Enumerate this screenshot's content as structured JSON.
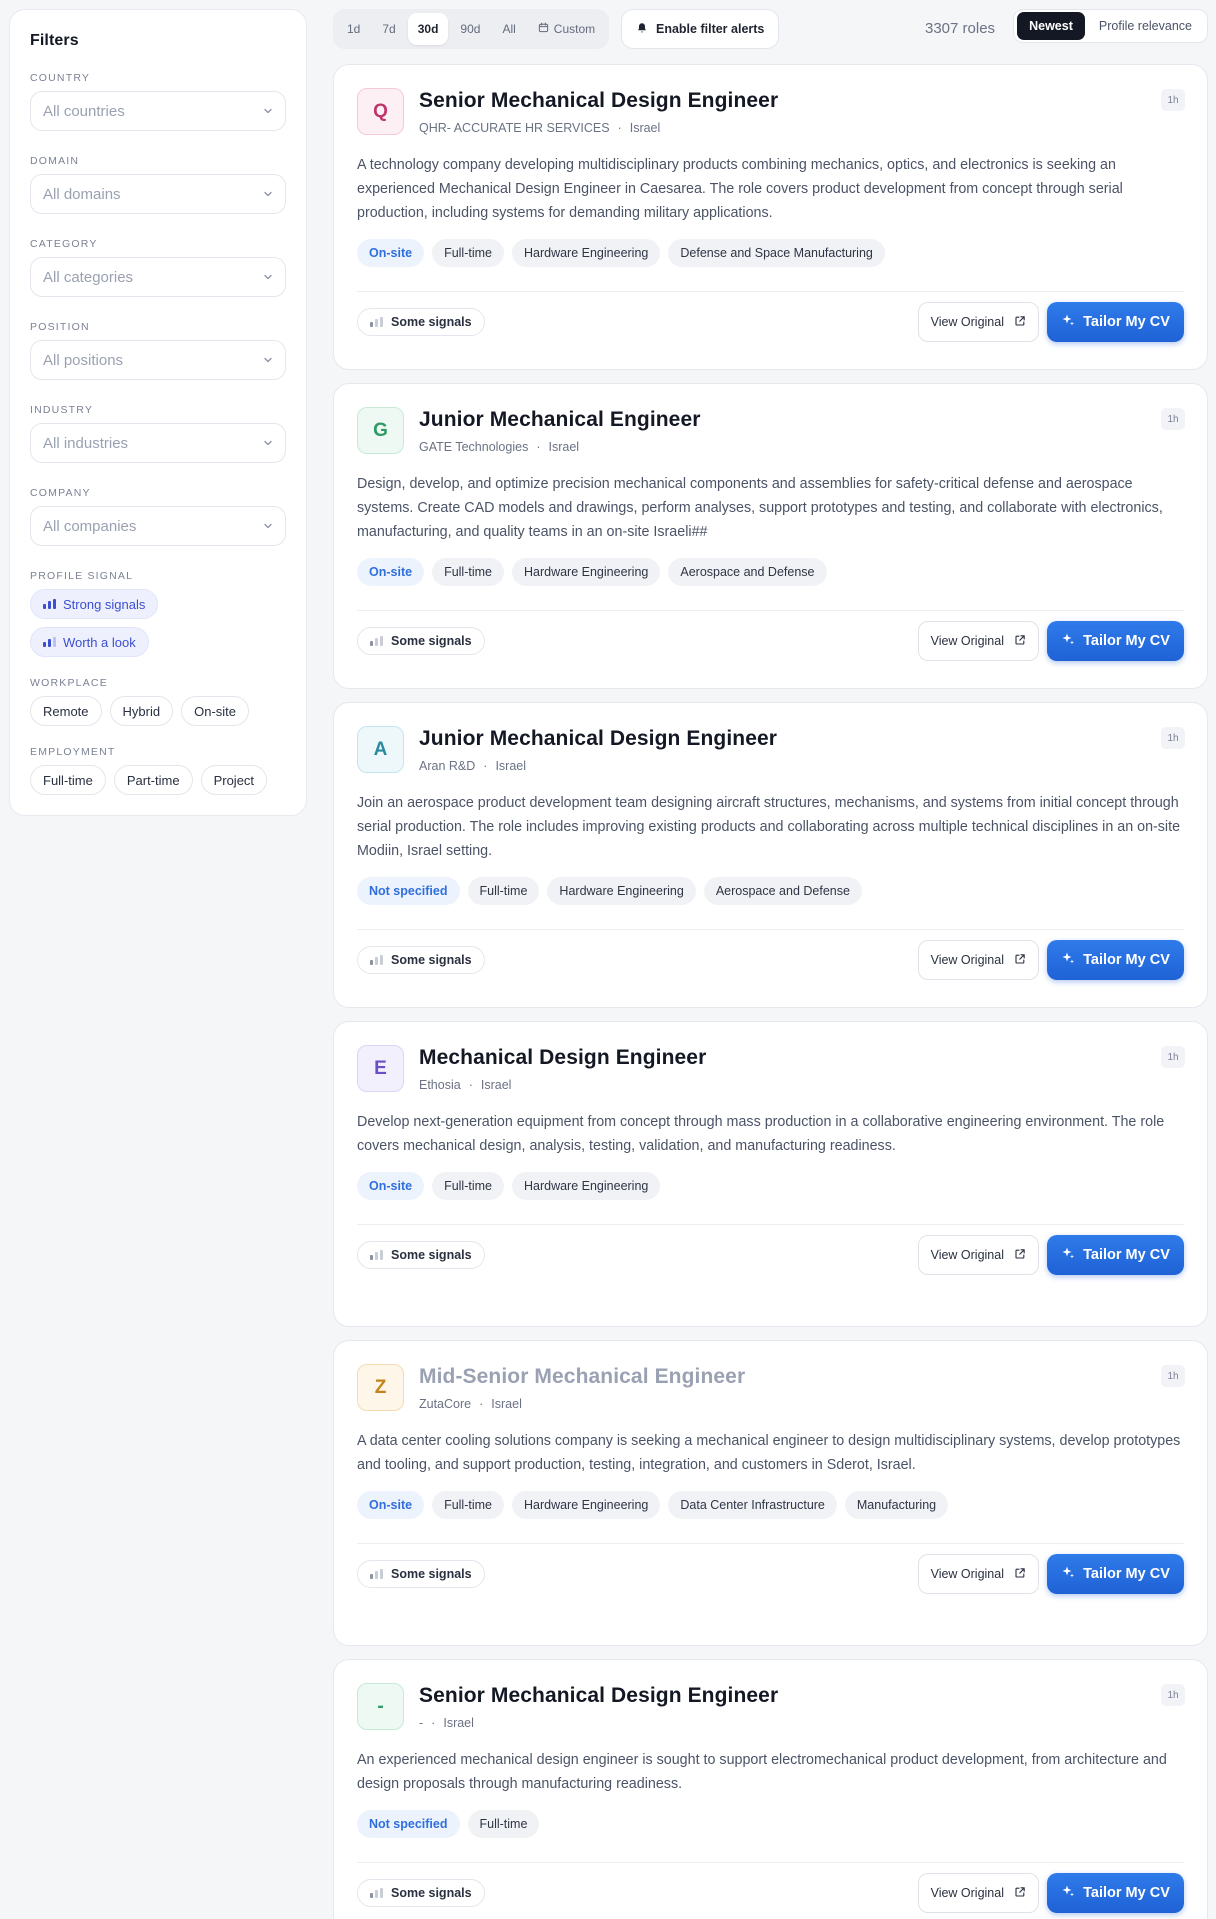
{
  "sidebar": {
    "title": "Filters",
    "country": {
      "label": "COUNTRY",
      "value": "All countries"
    },
    "domain": {
      "label": "DOMAIN",
      "value": "All domains"
    },
    "category": {
      "label": "CATEGORY",
      "value": "All categories"
    },
    "position": {
      "label": "POSITION",
      "value": "All positions"
    },
    "industry": {
      "label": "INDUSTRY",
      "value": "All industries"
    },
    "company": {
      "label": "COMPANY",
      "value": "All companies"
    },
    "profile_signal": {
      "label": "PROFILE SIGNAL",
      "options": [
        "Strong signals",
        "Worth a look"
      ]
    },
    "workplace": {
      "label": "WORKPLACE",
      "options": [
        "Remote",
        "Hybrid",
        "On-site"
      ]
    },
    "employment": {
      "label": "EMPLOYMENT",
      "options": [
        "Full-time",
        "Part-time",
        "Project"
      ]
    }
  },
  "topbar": {
    "ranges": [
      "1d",
      "7d",
      "30d",
      "90d",
      "All"
    ],
    "active_range": "30d",
    "custom_label": "Custom",
    "alerts_label": "Enable filter alerts",
    "roles_count": "3307 roles",
    "sort": [
      "Newest",
      "Profile relevance"
    ],
    "active_sort": "Newest"
  },
  "actions": {
    "view_original": "View Original",
    "tailor": "Tailor My CV",
    "signals": "Some signals"
  },
  "jobs": [
    {
      "initial": "Q",
      "title": "Senior Mechanical Design Engineer",
      "company": "QHR- ACCURATE HR SERVICES",
      "country": "Israel",
      "age": "1h",
      "description": "A technology company developing multidisciplinary products combining mechanics, optics, and electronics is seeking an experienced Mechanical Design Engineer in Caesarea. The role covers product development from concept through serial production, including systems for demanding military applications.",
      "location_type": "On-site",
      "tags": [
        "Full-time",
        "Hardware Engineering",
        "Defense and Space Manufacturing"
      ],
      "logo_color": "#c0356b",
      "logo_bg": "#fdf0f4",
      "logo_border": "#f4c9d7"
    },
    {
      "initial": "G",
      "title": "Junior Mechanical Engineer",
      "company": "GATE Technologies",
      "country": "Israel",
      "age": "1h",
      "description": "Design, develop, and optimize precision mechanical components and assemblies for safety-critical defense and aerospace systems. Create CAD models and drawings, perform analyses, support prototypes and testing, and collaborate with electronics, manufacturing, and quality teams in an on-site Israeli##",
      "location_type": "On-site",
      "tags": [
        "Full-time",
        "Hardware Engineering",
        "Aerospace and Defense"
      ],
      "logo_color": "#2f9a66",
      "logo_bg": "#eef9f3",
      "logo_border": "#c6ead6"
    },
    {
      "initial": "A",
      "title": "Junior Mechanical Design Engineer",
      "company": "Aran R&D",
      "country": "Israel",
      "age": "1h",
      "description": "Join an aerospace product development team designing aircraft structures, mechanisms, and systems from initial concept through serial production. The role includes improving existing products and collaborating across multiple technical disciplines in an on-site Modiin, Israel setting.",
      "location_type": "Not specified",
      "tags": [
        "Full-time",
        "Hardware Engineering",
        "Aerospace and Defense"
      ],
      "logo_color": "#2a8aa0",
      "logo_bg": "#eef8fb",
      "logo_border": "#c5e5ee"
    },
    {
      "initial": "E",
      "title": "Mechanical Design Engineer",
      "company": "Ethosia",
      "country": "Israel",
      "age": "1h",
      "description": "Develop next-generation equipment from concept through mass production in a collaborative engineering environment. The role covers mechanical design, analysis, testing, validation, and manufacturing readiness.",
      "location_type": "On-site",
      "tags": [
        "Full-time",
        "Hardware Engineering"
      ],
      "logo_color": "#6a4fc4",
      "logo_bg": "#f3f0fd",
      "logo_border": "#dcd3f6"
    },
    {
      "initial": "Z",
      "title": "Mid-Senior Mechanical Engineer",
      "company": "ZutaCore",
      "country": "Israel",
      "age": "1h",
      "description": "A data center cooling solutions company is seeking a mechanical engineer to design multidisciplinary systems, develop prototypes and tooling, and support production, testing, integration, and customers in Sderot, Israel.",
      "location_type": "On-site",
      "tags": [
        "Full-time",
        "Hardware Engineering",
        "Data Center Infrastructure",
        "Manufacturing"
      ],
      "logo_color": "#c4841c",
      "logo_bg": "#fdf6e9",
      "logo_border": "#f2ddb3",
      "muted": true
    },
    {
      "initial": "-",
      "title": "Senior Mechanical Design Engineer",
      "company": "-",
      "country": "Israel",
      "age": "1h",
      "description": "An experienced mechanical design engineer is sought to support electromechanical product development, from architecture and design proposals through manufacturing readiness.",
      "location_type": "Not specified",
      "tags": [
        "Full-time"
      ],
      "logo_color": "#2f9a66",
      "logo_bg": "#eef9f3",
      "logo_border": "#c6ead6"
    }
  ]
}
